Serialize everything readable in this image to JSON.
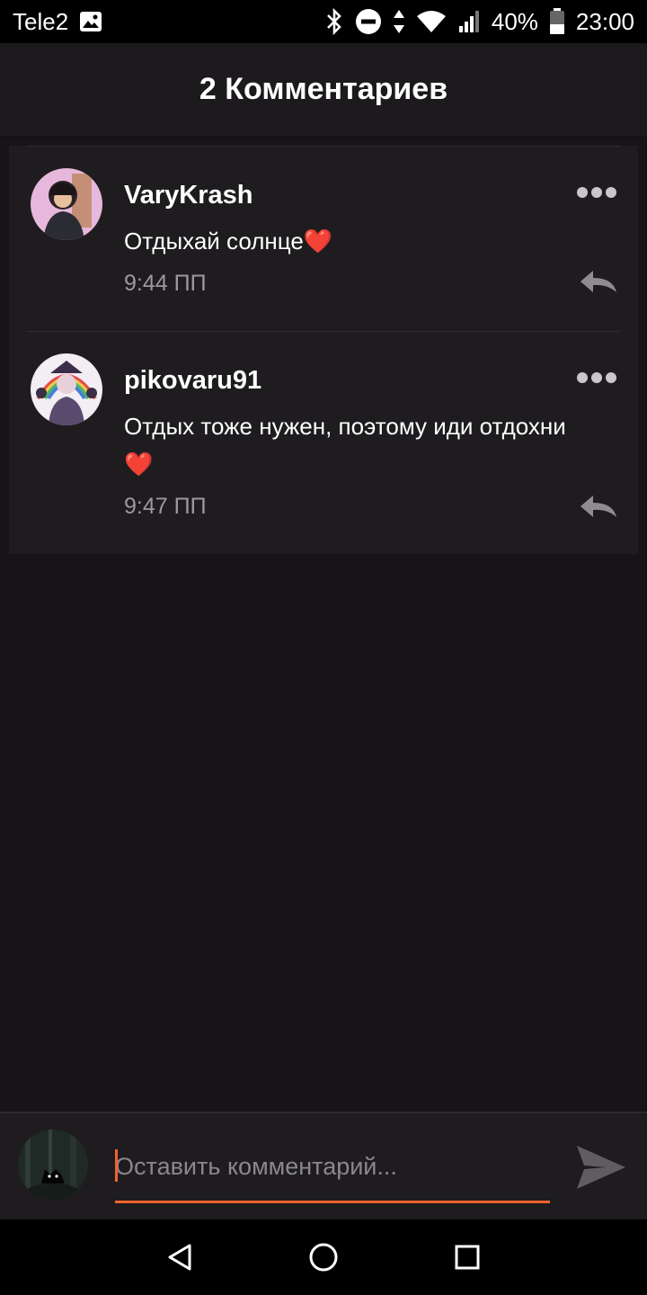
{
  "status_bar": {
    "carrier": "Tele2",
    "battery": "40%",
    "time": "23:00",
    "icons": [
      "image-icon",
      "bluetooth-icon",
      "do-not-disturb-icon",
      "data-arrows-icon",
      "wifi-icon",
      "signal-icon",
      "battery-icon"
    ]
  },
  "header": {
    "title": "2 Комментариев"
  },
  "comments": [
    {
      "username": "VaryKrash",
      "text": "Отдыхай солнце",
      "emoji": "❤️",
      "time": "9:44 ПП"
    },
    {
      "username": "pikovaru91",
      "text": "Отдых тоже нужен, поэтому иди отдохни",
      "emoji": "❤️",
      "time": "9:47 ПП"
    }
  ],
  "composer": {
    "placeholder": "Оставить комментарий...",
    "value": ""
  },
  "colors": {
    "accent": "#f0632d",
    "background": "#161417",
    "card": "#1e1c1f",
    "muted_text": "#9b999c",
    "heart": "#e0242a"
  },
  "nav": {
    "icons": [
      "back-icon",
      "home-icon",
      "recents-icon"
    ]
  }
}
